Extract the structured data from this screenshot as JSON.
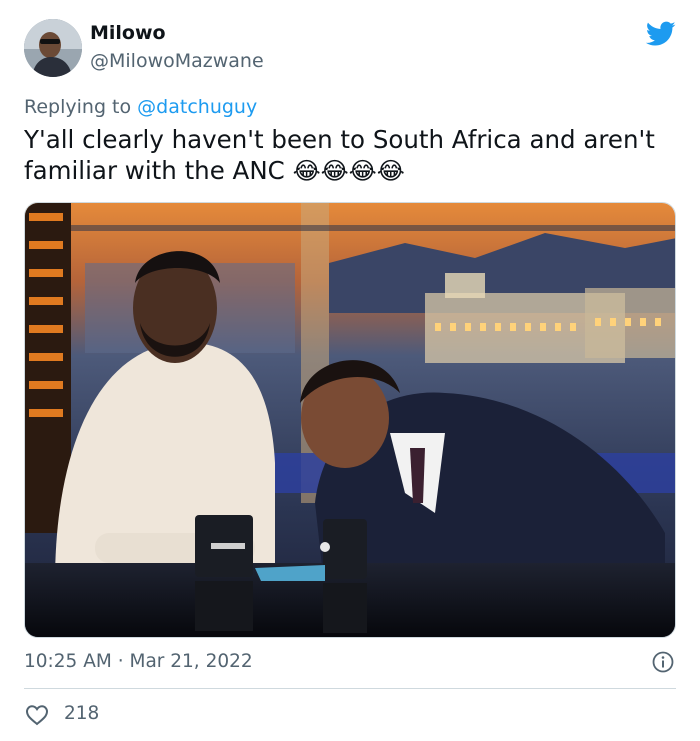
{
  "author": {
    "name": "Milowo",
    "handle": "@MilowoMazwane",
    "avatar_icon": "profile-photo"
  },
  "reply": {
    "prefix": "Replying to",
    "mention": "@datchuguy"
  },
  "tweet": {
    "text": "Y'all clearly haven't been to South Africa and aren't familiar with the ANC",
    "emojis": "😂😂😂😂"
  },
  "media": {
    "description_icon": "photo-two-men-laughing-at-talk-show-desk"
  },
  "footer": {
    "time": "10:25 AM",
    "separator": "·",
    "date": "Mar 21, 2022",
    "likes": "218"
  },
  "colors": {
    "twitter_blue": "#1d9bf0",
    "text_primary": "#0f1419",
    "text_secondary": "#536471",
    "border": "#cfd9de"
  },
  "icons": [
    "twitter-bird-icon",
    "info-icon",
    "heart-icon"
  ]
}
